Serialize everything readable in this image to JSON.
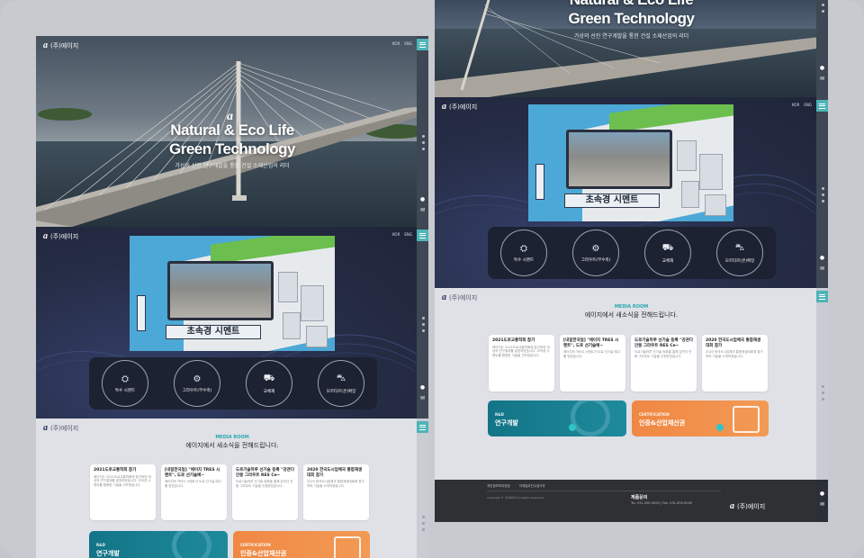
{
  "brand": {
    "mark": "a",
    "name": "(주)에이지"
  },
  "lang": [
    "KOR",
    "ENG"
  ],
  "hero": {
    "title1": "Natural & Eco Life",
    "title2": "Green Technology",
    "subtitle": "가상의 선진 연구개발을 통한 건설 소재산업의 리더"
  },
  "cement": {
    "label": "초속경 시멘트",
    "features": [
      "특수 시멘트",
      "그라우트(무수축)",
      "교체재",
      "모르타르(콘)확장"
    ]
  },
  "media": {
    "tag": "MEDIA ROOM",
    "title": "에이지에서 새소식을 전해드립니다.",
    "news": [
      {
        "title": "2021도로교통학회 참가",
        "body": "에이지는 2021도로교통학회에 참가하여 대상의 연구결과를 발표하였습니다. 초속경 시멘트를 활용한 기술을 선보였습니다."
      },
      {
        "title": "[내일한국일] \"에이지 TRES 시멘트\", 도로 선기술예~",
        "body": "에이지의 TRES 시멘트가 도로 선기술 예고를 받았습니다."
      },
      {
        "title": "도로기술하루 선기술 등록 \"강관다 안봉 그라우트 RES Ce~",
        "body": "도로기술하루 선기술 등록을 통해 강관다 안봉 그라우트 기술을 인정받았습니다."
      },
      {
        "title": "2020 한국도시업체국 통합재생대회 참가",
        "body": "2020 한국도시업체국 통합재생대회에 참가하여 기술을 소개하였습니다."
      }
    ],
    "cta": [
      {
        "key": "R&D",
        "value": "연구개발"
      },
      {
        "key": "CERTIFICATION",
        "value": "인증&산업재산권"
      }
    ]
  },
  "footer": {
    "links": [
      "개인정보처리방침",
      "이메일무단수집거부"
    ],
    "contact_title": "제품문의",
    "contact": "Tel. 031-000-0000 | Fax. 031-000-0000",
    "copyright": "Copyright © (주)에이지 All Rights Reserved."
  },
  "colors": {
    "accent": "#4fb4b8",
    "navy": "#252c45",
    "orange": "#f08844",
    "teal": "#137487"
  }
}
